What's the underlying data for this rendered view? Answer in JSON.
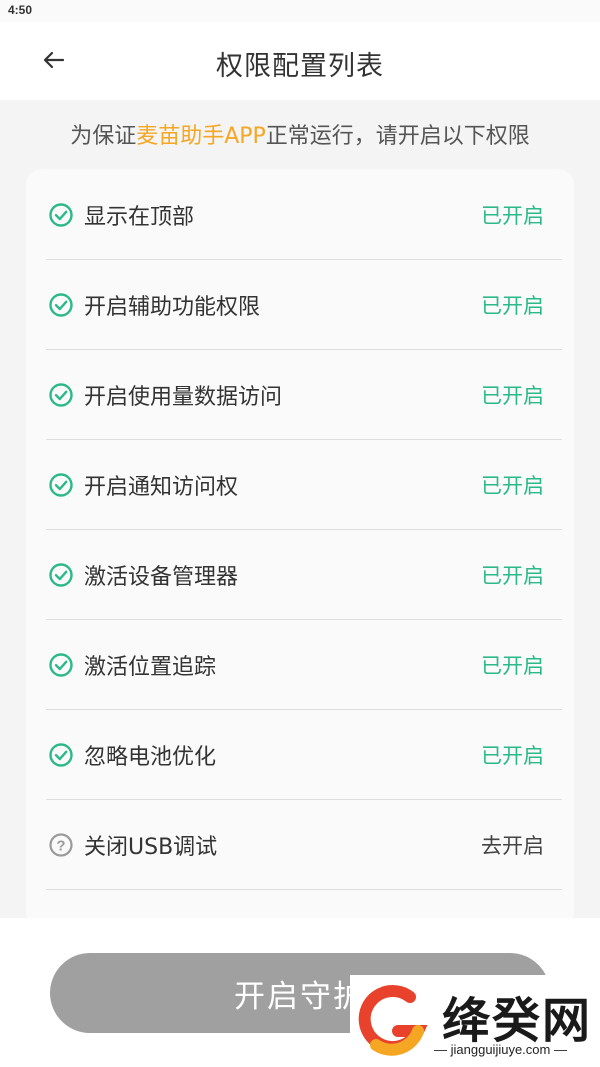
{
  "status_bar": {
    "time": "4:50"
  },
  "header": {
    "title": "权限配置列表",
    "back_icon": "arrow-left-icon"
  },
  "subtitle": {
    "prefix": "为保证",
    "app_name": "麦苗助手APP",
    "suffix": "正常运行，请开启以下权限",
    "highlight_color": "#f5a623"
  },
  "permissions": [
    {
      "label": "显示在顶部",
      "status": "已开启",
      "enabled": true
    },
    {
      "label": "开启辅助功能权限",
      "status": "已开启",
      "enabled": true
    },
    {
      "label": "开启使用量数据访问",
      "status": "已开启",
      "enabled": true
    },
    {
      "label": "开启通知访问权",
      "status": "已开启",
      "enabled": true
    },
    {
      "label": "激活设备管理器",
      "status": "已开启",
      "enabled": true
    },
    {
      "label": "激活位置追踪",
      "status": "已开启",
      "enabled": true
    },
    {
      "label": "忽略电池优化",
      "status": "已开启",
      "enabled": true
    },
    {
      "label": "关闭USB调试",
      "status": "去开启",
      "enabled": false
    }
  ],
  "colors": {
    "enabled": "#2bb88a",
    "disabled_icon": "#9a9a9a",
    "button_bg": "#a0a0a0"
  },
  "guard_button": {
    "label": "开启守护"
  },
  "watermark": {
    "brand": "绛癸网",
    "url": "jiangguijiuye.com"
  }
}
